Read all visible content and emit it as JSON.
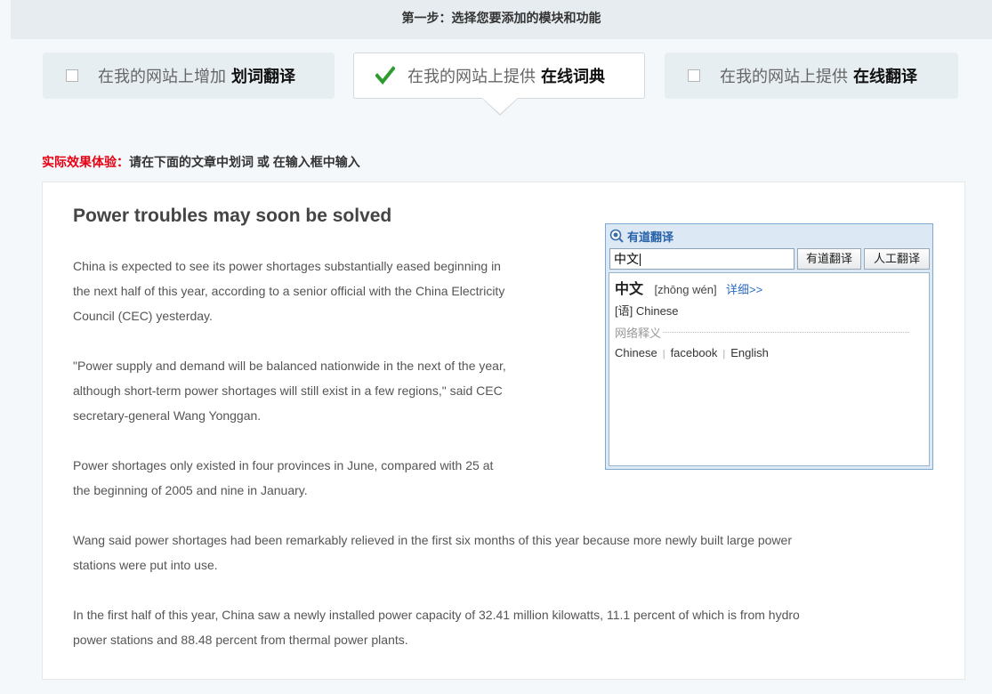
{
  "step": {
    "title": "第一步：选择您要添加的模块和功能"
  },
  "modules": [
    {
      "prefix": "在我的网站上增加",
      "name": "划词翻译",
      "checked": false
    },
    {
      "prefix": "在我的网站上提供",
      "name": "在线词典",
      "checked": true
    },
    {
      "prefix": "在我的网站上提供",
      "name": "在线翻译",
      "checked": false
    }
  ],
  "hint": {
    "label": "实际效果体验：",
    "text": "请在下面的文章中划词 或 在输入框中输入"
  },
  "article": {
    "title": "Power troubles may soon be solved",
    "paragraphs": [
      [
        "China is expected to see its power shortages substantially eased beginning in",
        "the next half of this year, according to a senior official with the China Electricity",
        "Council (CEC) yesterday."
      ],
      [
        "\"Power supply and demand will be balanced nationwide in the next of the year,",
        "although short-term power shortages will still exist in a few regions,\" said CEC",
        "secretary-general Wang Yonggan."
      ],
      [
        "Power shortages only existed in four provinces in June, compared with 25 at",
        "the beginning of 2005 and nine in January."
      ],
      [
        "Wang said power shortages had been remarkably relieved in the first six months of this year because more newly built large power",
        "stations were put into use."
      ],
      [
        "In the first half of this year, China saw a newly installed power capacity of 32.41 million kilowatts, 11.1 percent of which is from hydro",
        "power stations and 88.48 percent from thermal power plants."
      ]
    ]
  },
  "dict": {
    "title": "有道翻译",
    "input_value": "中文",
    "translate_button": "有道翻译",
    "human_button": "人工翻译",
    "result": {
      "word": "中文",
      "pinyin": "[zhōng wén]",
      "detail_link": "详细>>",
      "definition": "[语] Chinese",
      "web_section": "网络释义",
      "web_items": [
        "Chinese",
        "facebook",
        "English"
      ]
    }
  },
  "colors": {
    "accent_red": "#e60012",
    "link_blue": "#2b6dc0",
    "check_green": "#2e9b2e"
  }
}
